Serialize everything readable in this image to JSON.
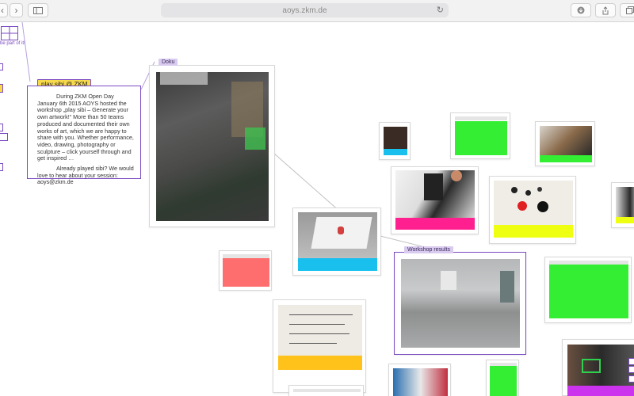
{
  "browser": {
    "url": "aoys.zkm.de"
  },
  "sidebar": {
    "tagline": "be part of it!"
  },
  "post": {
    "tag": "play sibi @ ZKM",
    "paragraph1": "During ZKM Open Day January 6th 2015 AOYS hosted the workshop „play sibi – Generate your own artwork!“ More than 50 teams produced and documented their own works of art, which we are happy to share with you. Whether performance, video, drawing, photography or sculpture – click yourself through and get inspired …",
    "paragraph2": "Already played sibi? We would love to hear about your session: aoys@zkm.de"
  },
  "labels": {
    "doku": "Doku",
    "workshop_results": "Workshop results"
  },
  "colors": {
    "accent_purple": "#7a4ac0",
    "tag_yellow": "#f7d94c",
    "green": "#33ee33",
    "cyan": "#19c0ee",
    "pink": "#ff1f8f",
    "lime": "#eeff11",
    "orange": "#ffc21a",
    "salmon": "#ff6e6e",
    "violet": "#cc33ee"
  },
  "icons": [
    "back-arrow-icon",
    "forward-arrow-icon",
    "sidebar-icon",
    "reload-icon",
    "download-icon",
    "share-icon",
    "tabs-icon"
  ]
}
